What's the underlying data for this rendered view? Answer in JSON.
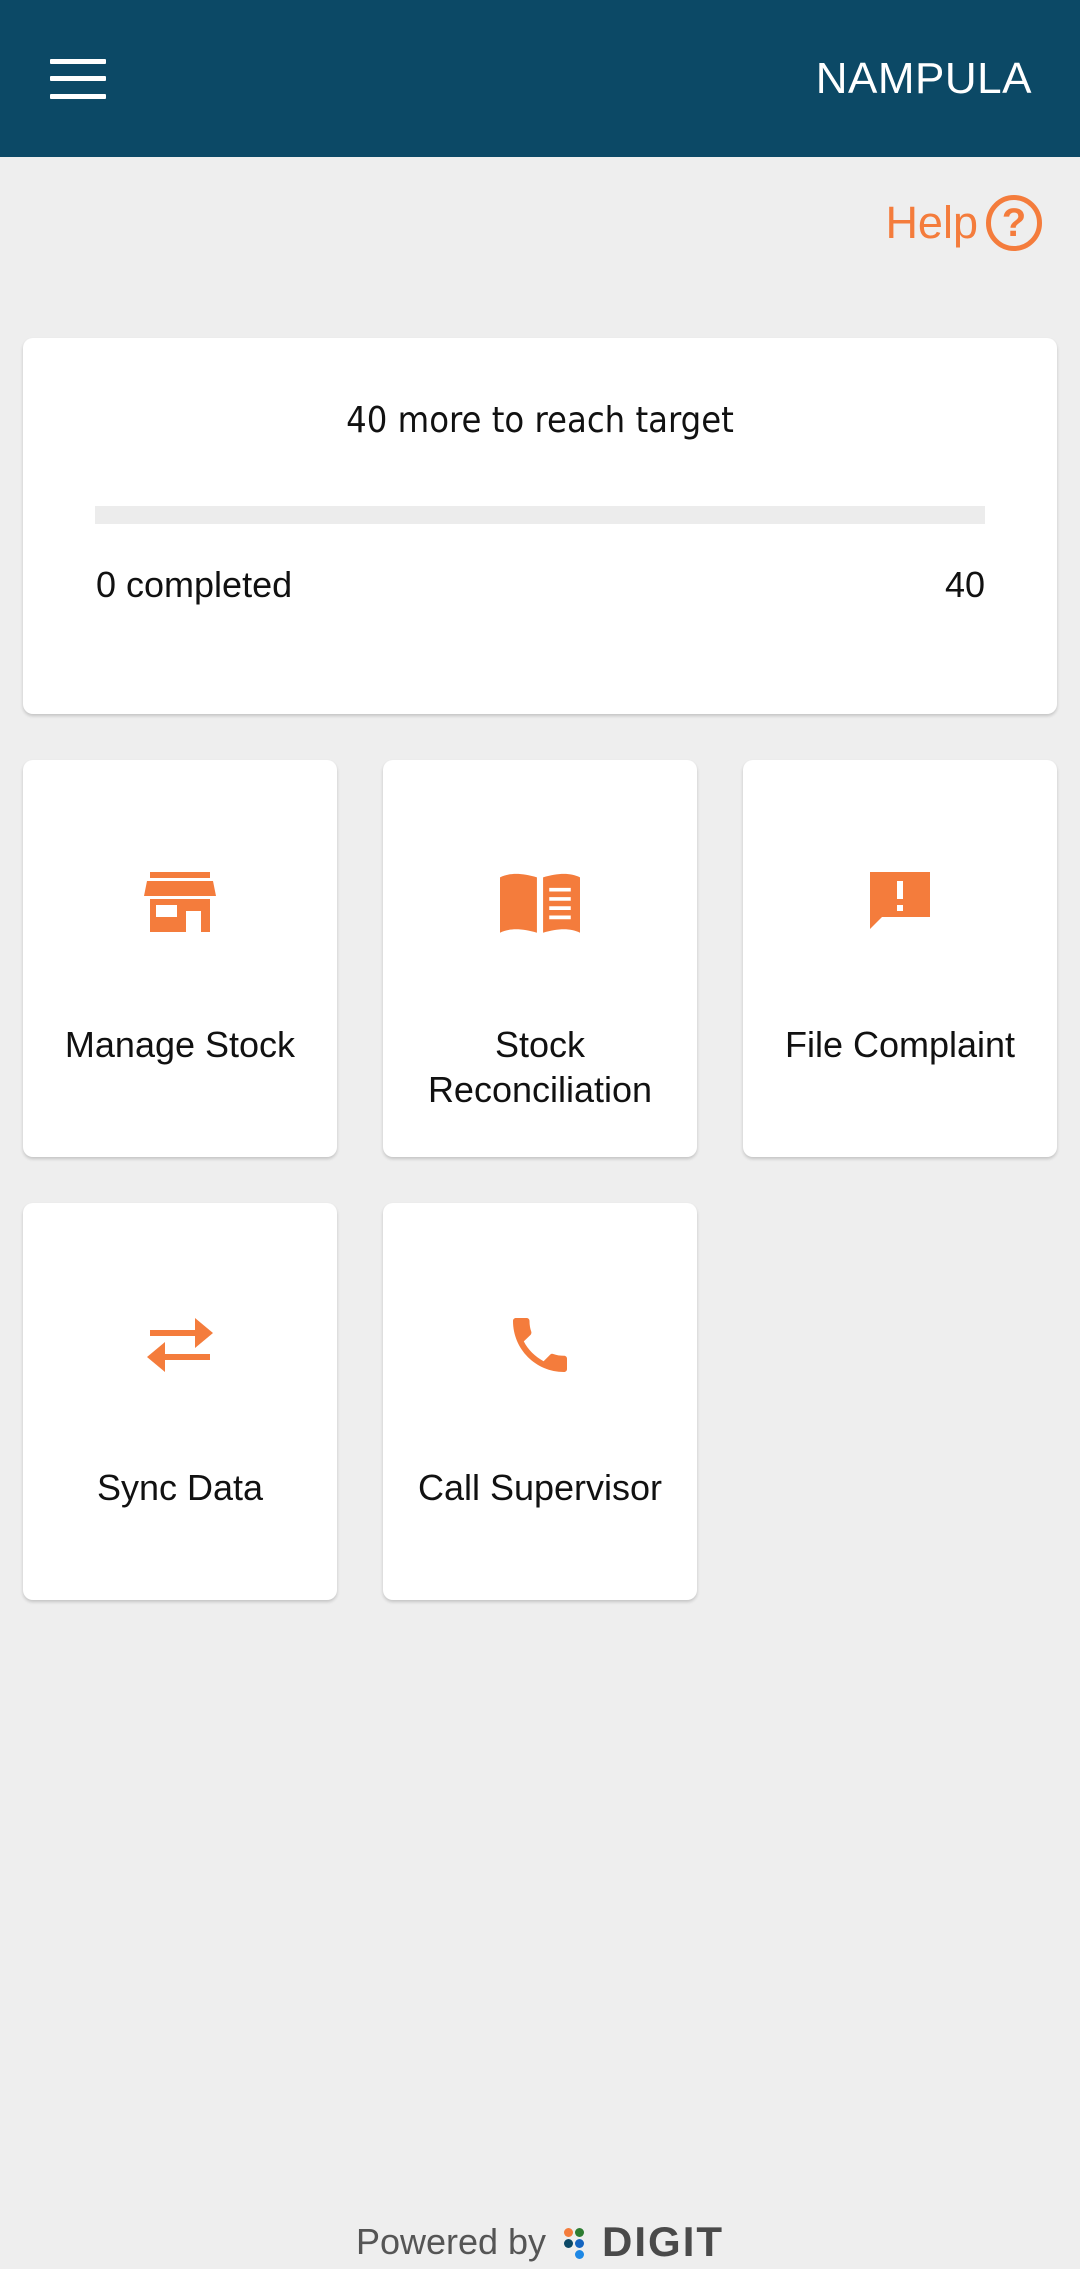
{
  "header": {
    "title": "NAMPULA",
    "menu_icon": "hamburger-menu-icon"
  },
  "help": {
    "label": "Help",
    "icon_glyph": "?",
    "icon": "help-circle-icon"
  },
  "progress": {
    "title": "40 more to reach target",
    "completed_label": "0 completed",
    "target_label": "40",
    "completed": 0,
    "target": 40
  },
  "tiles": [
    {
      "label": "Manage Stock",
      "icon": "store-icon"
    },
    {
      "label": "Stock Reconciliation",
      "icon": "open-book-icon"
    },
    {
      "label": "File Complaint",
      "icon": "feedback-alert-icon"
    },
    {
      "label": "Sync Data",
      "icon": "swap-arrows-icon"
    },
    {
      "label": "Call Supervisor",
      "icon": "phone-icon"
    }
  ],
  "footer": {
    "powered_by": "Powered by",
    "brand": "DIGIT"
  },
  "colors": {
    "app_bar": "#0c4966",
    "accent": "#f47c3c",
    "background": "#eeeeee"
  }
}
